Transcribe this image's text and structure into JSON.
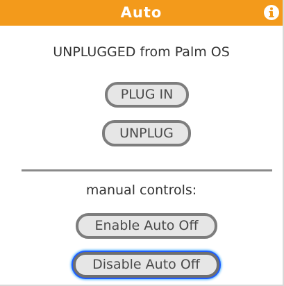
{
  "window": {
    "title": "Auto",
    "accent": "#f39a1b",
    "info_icon": "info-icon"
  },
  "status": {
    "text": "UNPLUGGED from Palm OS"
  },
  "buttons": {
    "plug_in": "PLUG IN",
    "unplug": "UNPLUG",
    "enable_auto_off": "Enable Auto Off",
    "disable_auto_off": "Disable Auto Off"
  },
  "manual": {
    "label": "manual controls:"
  },
  "focus": {
    "color": "#1e5cff",
    "focused_button": "disable_auto_off"
  }
}
